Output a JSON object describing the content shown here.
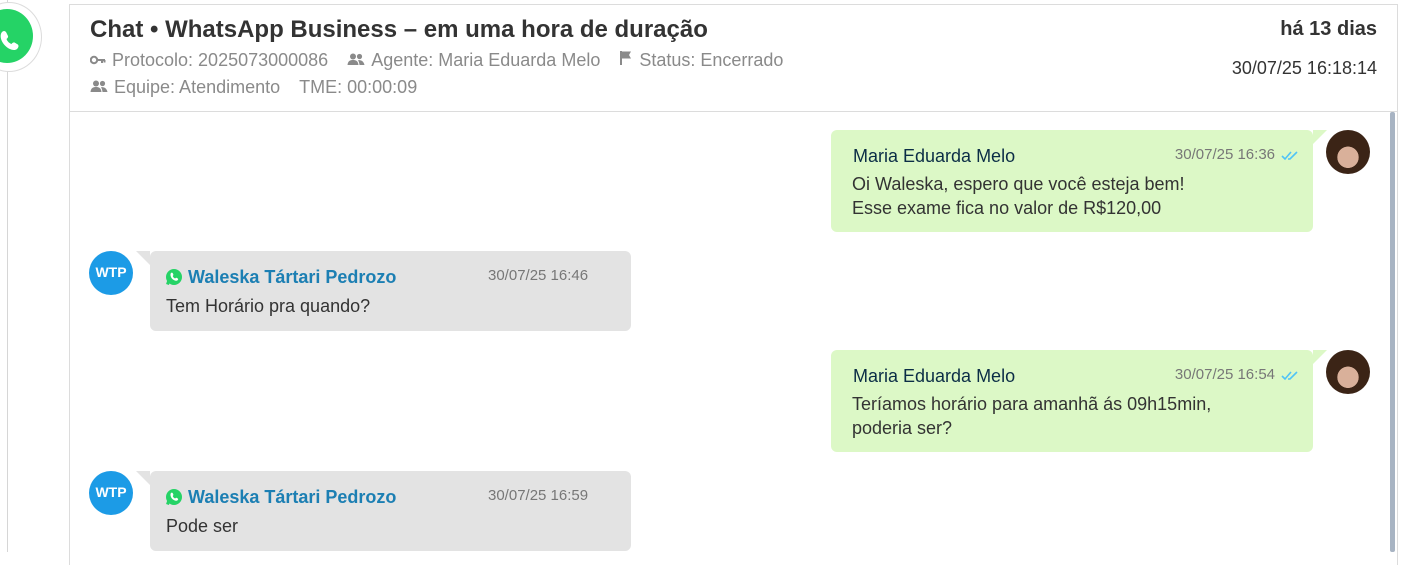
{
  "header": {
    "title": "Chat • WhatsApp Business – em uma hora de duração",
    "protocol": "Protocolo: 2025073000086",
    "agent": "Agente: Maria Eduarda Melo",
    "status": "Status: Encerrado",
    "team": "Equipe: Atendimento",
    "tme": "TME: 00:00:09",
    "age": "há 13 dias",
    "datetime": "30/07/25 16:18:14"
  },
  "messages": [
    {
      "direction": "outgoing",
      "sender": "Maria Eduarda Melo",
      "time": "30/07/25 16:36",
      "lines": [
        "Oi Waleska, espero que você esteja bem!",
        "Esse exame fica no valor de R$120,00"
      ],
      "read": true
    },
    {
      "direction": "incoming",
      "sender": "Waleska Tártari Pedrozo",
      "initials": "WTP",
      "time": "30/07/25 16:46",
      "lines": [
        "Tem Horário pra quando?"
      ]
    },
    {
      "direction": "outgoing",
      "sender": "Maria Eduarda Melo",
      "time": "30/07/25 16:54",
      "lines": [
        "Teríamos horário para amanhã ás 09h15min,",
        "poderia ser?"
      ],
      "read": true
    },
    {
      "direction": "incoming",
      "sender": "Waleska Tártari Pedrozo",
      "initials": "WTP",
      "time": "30/07/25 16:59",
      "lines": [
        "Pode ser"
      ]
    }
  ],
  "colors": {
    "whatsapp_green": "#25d366",
    "outgoing_bubble": "#dcf8c6",
    "incoming_bubble": "#e3e3e3",
    "contact_name": "#1c7fb3",
    "badge": "#1c9be6",
    "read_ticks": "#4fc3f7"
  },
  "icons": {
    "channel": "whatsapp-icon",
    "protocol": "key-icon",
    "agent": "users-icon",
    "status": "flag-icon",
    "team": "users-icon",
    "read": "double-check-icon"
  }
}
